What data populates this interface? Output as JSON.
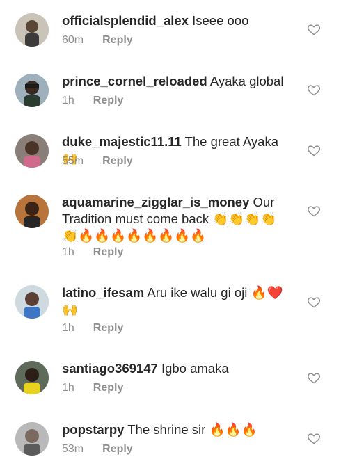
{
  "comments": [
    {
      "username": "officialsplendid_alex",
      "text": "Iseee ooo",
      "time": "60m",
      "reply_label": "Reply",
      "avatar_icon": "user-avatar-photo",
      "like_icon": "heart-outline-icon"
    },
    {
      "username": "prince_cornel_reloaded",
      "text": "Ayaka global",
      "time": "1h",
      "reply_label": "Reply",
      "avatar_icon": "user-avatar-photo",
      "like_icon": "heart-outline-icon"
    },
    {
      "username": "duke_majestic11.11",
      "text": "The great Ayaka🙌",
      "time": "55m",
      "reply_label": "Reply",
      "avatar_icon": "user-avatar-photo",
      "like_icon": "heart-outline-icon"
    },
    {
      "username": "aquamarine_zigglar_is_money",
      "text": "Our Tradition must come back 👏👏👏👏👏🔥🔥🔥🔥🔥🔥🔥🔥",
      "time": "1h",
      "reply_label": "Reply",
      "avatar_icon": "user-avatar-photo",
      "like_icon": "heart-outline-icon"
    },
    {
      "username": "latino_ifesam",
      "text": "Aru ike walu gi oji 🔥❤️🙌",
      "time": "1h",
      "reply_label": "Reply",
      "avatar_icon": "user-avatar-photo",
      "like_icon": "heart-outline-icon"
    },
    {
      "username": "santiago369147",
      "text": "Igbo amaka",
      "time": "1h",
      "reply_label": "Reply",
      "avatar_icon": "user-avatar-photo",
      "like_icon": "heart-outline-icon"
    },
    {
      "username": "popstarpy",
      "text": "The shrine sir 🔥🔥🔥",
      "time": "53m",
      "reply_label": "Reply",
      "avatar_icon": "user-avatar-photo",
      "like_icon": "heart-outline-icon"
    }
  ],
  "colors": {
    "text": "#262626",
    "secondary": "#8e8e8e",
    "background": "#ffffff"
  }
}
